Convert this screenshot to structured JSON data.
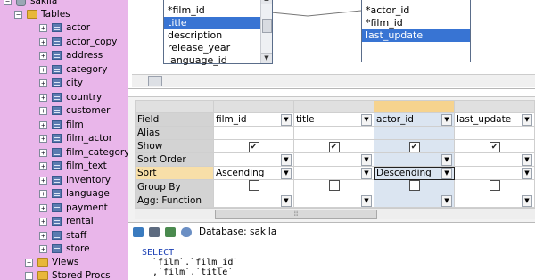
{
  "tree": {
    "db": "sakila",
    "tables_label": "Tables",
    "tables": [
      "actor",
      "actor_copy",
      "address",
      "category",
      "city",
      "country",
      "customer",
      "film",
      "film_actor",
      "film_category",
      "film_text",
      "inventory",
      "language",
      "payment",
      "rental",
      "staff",
      "store"
    ],
    "views_label": "Views",
    "procs_label": "Stored Procs"
  },
  "diagram": {
    "left_table_items": [
      "*film_id",
      "title",
      "description",
      "release_year",
      "language_id"
    ],
    "left_selected_index": 1,
    "right_table_items": [
      "*actor_id",
      "*film_id",
      "last_update"
    ],
    "right_selected_index": 2
  },
  "grid": {
    "row_labels": [
      "Field",
      "Alias",
      "Show",
      "Sort Order",
      "Sort",
      "Group By",
      "Agg: Function"
    ],
    "columns": [
      {
        "field": "film_id",
        "show": true,
        "sort": "Ascending",
        "group": false
      },
      {
        "field": "title",
        "show": true,
        "sort": "",
        "group": false
      },
      {
        "field": "actor_id",
        "show": true,
        "sort": "Descending",
        "group": false
      },
      {
        "field": "last_update",
        "show": true,
        "sort": "",
        "group": false
      }
    ]
  },
  "sql": {
    "database_label": "Database: sakila",
    "lines": [
      "SELECT",
      "  `film`.`film_id`",
      "  ,`film`.`title`"
    ]
  }
}
